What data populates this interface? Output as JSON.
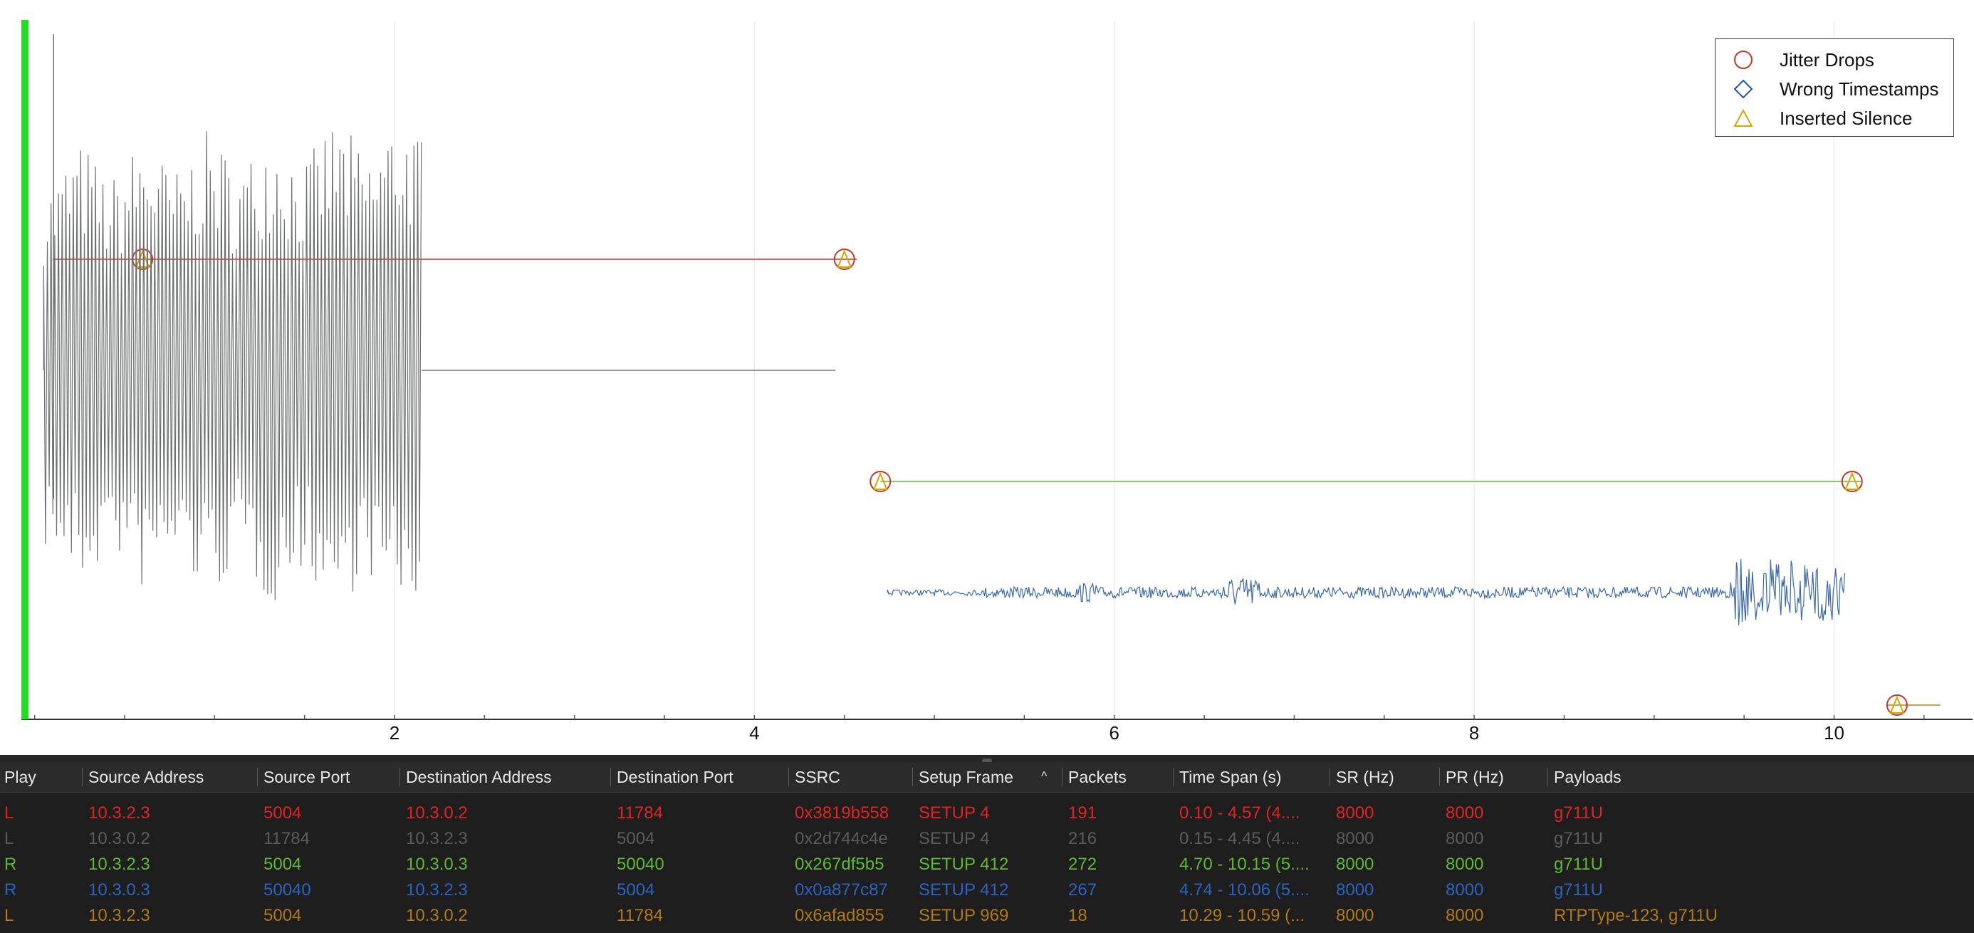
{
  "chart_data": {
    "type": "waveform",
    "x_ticks": [
      "2",
      "4",
      "6",
      "8",
      "10"
    ],
    "x_tick_values": [
      2,
      4,
      6,
      8,
      10
    ],
    "xlim": [
      -0.05,
      10.75
    ],
    "playhead_time": 0.0,
    "streams": [
      {
        "color": "#d32f2f",
        "t_start": 0.1,
        "t_end": 4.57,
        "kind": "line",
        "lane": 1,
        "markers": [
          {
            "t": 0.6,
            "type": "jitter"
          },
          {
            "t": 4.5,
            "type": "jitter"
          }
        ]
      },
      {
        "color": "#6e7070",
        "t_start": 0.05,
        "t_end": 2.15,
        "kind": "dense-wave",
        "lane": 2,
        "flat_until": 4.45
      },
      {
        "color": "#63b23a",
        "t_start": 4.7,
        "t_end": 10.15,
        "kind": "line",
        "lane": 3,
        "markers": [
          {
            "t": 4.7,
            "type": "jitter"
          },
          {
            "t": 10.1,
            "type": "jitter"
          }
        ]
      },
      {
        "color": "#3a68a8",
        "t_start": 4.74,
        "t_end": 10.06,
        "kind": "noise-wave",
        "lane": 4
      },
      {
        "color": "#b8801a",
        "t_start": 10.29,
        "t_end": 10.59,
        "kind": "line",
        "lane": 5,
        "markers": [
          {
            "t": 10.35,
            "type": "jitter"
          }
        ]
      }
    ]
  },
  "legend": {
    "items": [
      {
        "label": "Jitter Drops",
        "symbol": "circle",
        "color": "#c0392b"
      },
      {
        "label": "Wrong Timestamps",
        "symbol": "diamond",
        "color": "#2155a8"
      },
      {
        "label": "Inserted Silence",
        "symbol": "triangle",
        "color": "#d4a600"
      }
    ]
  },
  "table": {
    "columns": [
      "Play",
      "Source Address",
      "Source Port",
      "Destination Address",
      "Destination Port",
      "SSRC",
      "Setup Frame",
      "Packets",
      "Time Span (s)",
      "SR (Hz)",
      "PR (Hz)",
      "Payloads"
    ],
    "sort_icon": "chevron-up-icon",
    "rows": [
      {
        "color": "#e02424",
        "cells": [
          "L",
          "10.3.2.3",
          "5004",
          "10.3.0.2",
          "11784",
          "0x3819b558",
          "SETUP 4",
          "191",
          "0.10 - 4.57 (4....",
          "8000",
          "8000",
          "g711U"
        ]
      },
      {
        "color": "#5c5c5c",
        "cells": [
          "L",
          "10.3.0.2",
          "11784",
          "10.3.2.3",
          "5004",
          "0x2d744c4e",
          "SETUP 4",
          "216",
          "0.15 - 4.45 (4....",
          "8000",
          "8000",
          "g711U"
        ]
      },
      {
        "color": "#5fb832",
        "cells": [
          "R",
          "10.3.2.3",
          "5004",
          "10.3.0.3",
          "50040",
          "0x267df5b5",
          "SETUP 412",
          "272",
          "4.70 - 10.15 (5....",
          "8000",
          "8000",
          "g711U"
        ]
      },
      {
        "color": "#2d63c0",
        "cells": [
          "R",
          "10.3.0.3",
          "50040",
          "10.3.2.3",
          "5004",
          "0x0a877c87",
          "SETUP 412",
          "267",
          "4.74 - 10.06 (5....",
          "8000",
          "8000",
          "g711U"
        ]
      },
      {
        "color": "#b07818",
        "cells": [
          "L",
          "10.3.2.3",
          "5004",
          "10.3.0.2",
          "11784",
          "0x6afad855",
          "SETUP 969",
          "18",
          "10.29 - 10.59 (...",
          "8000",
          "8000",
          "RTPType-123, g711U"
        ]
      }
    ]
  }
}
